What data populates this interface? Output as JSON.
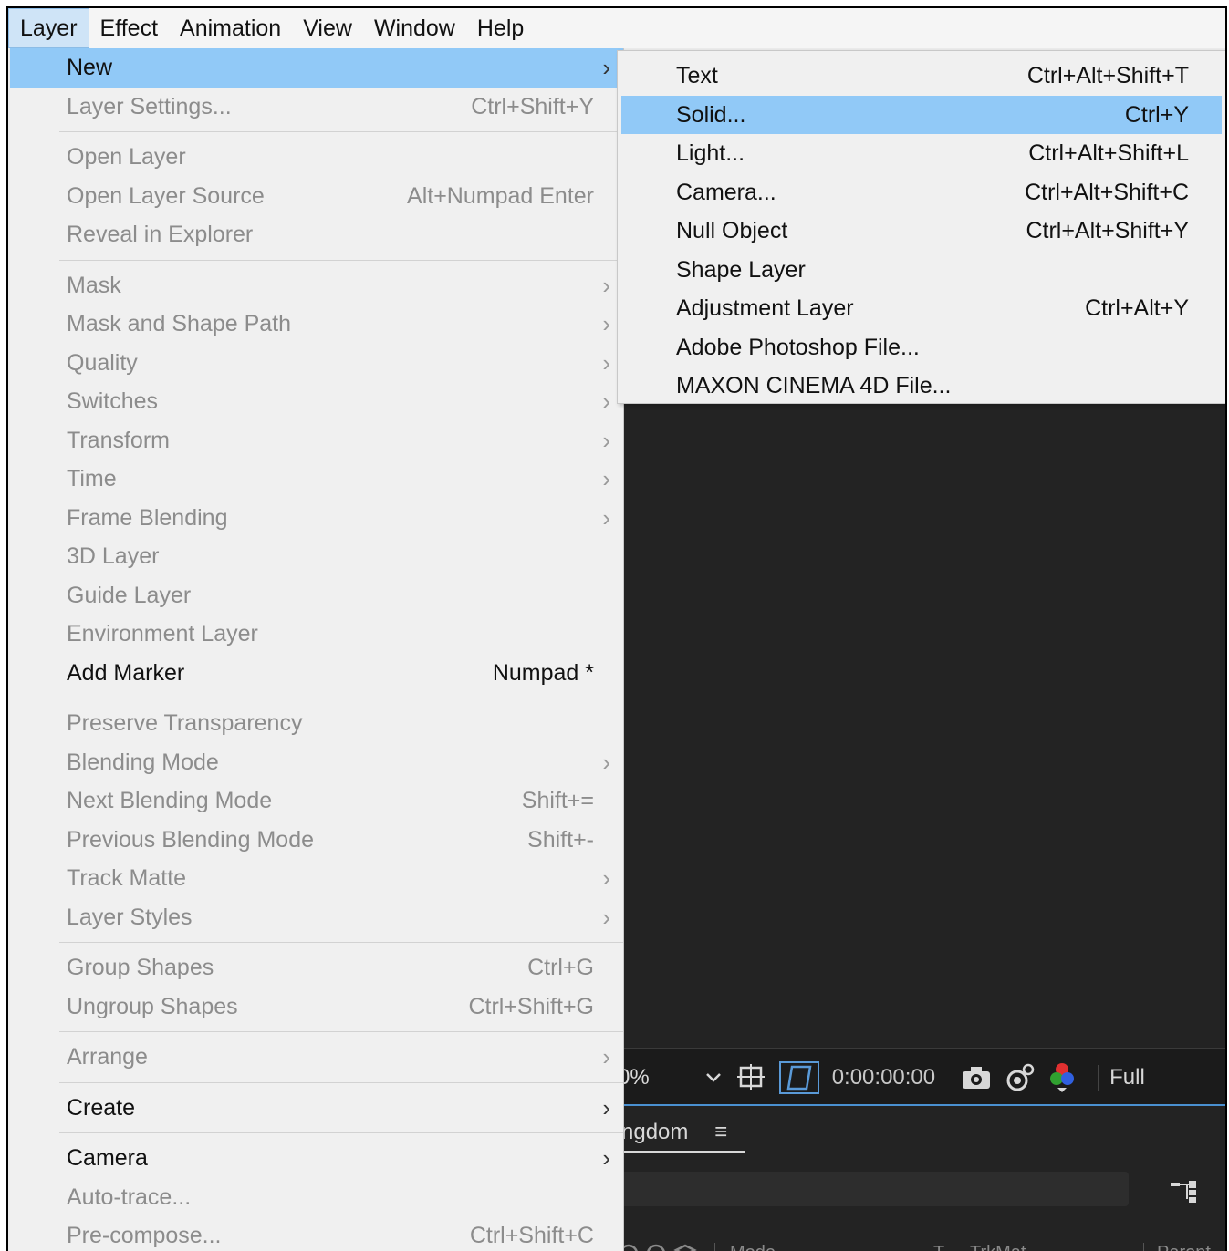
{
  "menubar": {
    "items": [
      "Layer",
      "Effect",
      "Animation",
      "View",
      "Window",
      "Help"
    ],
    "active": "Layer"
  },
  "layer_menu": {
    "new": {
      "label": "New"
    },
    "layer_settings": {
      "label": "Layer Settings...",
      "shortcut": "Ctrl+Shift+Y"
    },
    "open_layer": {
      "label": "Open Layer"
    },
    "open_layer_source": {
      "label": "Open Layer Source",
      "shortcut": "Alt+Numpad Enter"
    },
    "reveal_in_explorer": {
      "label": "Reveal in Explorer"
    },
    "mask": {
      "label": "Mask"
    },
    "mask_and_shape_path": {
      "label": "Mask and Shape Path"
    },
    "quality": {
      "label": "Quality"
    },
    "switches": {
      "label": "Switches"
    },
    "transform": {
      "label": "Transform"
    },
    "time": {
      "label": "Time"
    },
    "frame_blending": {
      "label": "Frame Blending"
    },
    "three_d_layer": {
      "label": "3D Layer"
    },
    "guide_layer": {
      "label": "Guide Layer"
    },
    "environment_layer": {
      "label": "Environment Layer"
    },
    "add_marker": {
      "label": "Add Marker",
      "shortcut": "Numpad *"
    },
    "preserve_transparency": {
      "label": "Preserve Transparency"
    },
    "blending_mode": {
      "label": "Blending Mode"
    },
    "next_blending_mode": {
      "label": "Next Blending Mode",
      "shortcut": "Shift+="
    },
    "previous_blending_mode": {
      "label": "Previous Blending Mode",
      "shortcut": "Shift+-"
    },
    "track_matte": {
      "label": "Track Matte"
    },
    "layer_styles": {
      "label": "Layer Styles"
    },
    "group_shapes": {
      "label": "Group Shapes",
      "shortcut": "Ctrl+G"
    },
    "ungroup_shapes": {
      "label": "Ungroup Shapes",
      "shortcut": "Ctrl+Shift+G"
    },
    "arrange": {
      "label": "Arrange"
    },
    "create": {
      "label": "Create"
    },
    "camera": {
      "label": "Camera"
    },
    "auto_trace": {
      "label": "Auto-trace..."
    },
    "pre_compose": {
      "label": "Pre-compose...",
      "shortcut": "Ctrl+Shift+C"
    }
  },
  "new_submenu": {
    "text": {
      "label": "Text",
      "shortcut": "Ctrl+Alt+Shift+T"
    },
    "solid": {
      "label": "Solid...",
      "shortcut": "Ctrl+Y"
    },
    "light": {
      "label": "Light...",
      "shortcut": "Ctrl+Alt+Shift+L"
    },
    "camera": {
      "label": "Camera...",
      "shortcut": "Ctrl+Alt+Shift+C"
    },
    "null_object": {
      "label": "Null Object",
      "shortcut": "Ctrl+Alt+Shift+Y"
    },
    "shape_layer": {
      "label": "Shape Layer"
    },
    "adjustment_layer": {
      "label": "Adjustment Layer",
      "shortcut": "Ctrl+Alt+Y"
    },
    "photoshop_file": {
      "label": "Adobe Photoshop File..."
    },
    "cinema4d_file": {
      "label": "MAXON CINEMA 4D File..."
    }
  },
  "viewer": {
    "zoom_partial": "0%",
    "timecode": "0:00:00:00",
    "resolution": "Full"
  },
  "timeline": {
    "tab_partial": "ngdom",
    "tab_menu_glyph": "≡",
    "col_mode": "Mode",
    "col_t": "T",
    "col_trkmat": "TrkMat",
    "col_parent": "Parent &"
  },
  "colors": {
    "highlight": "#91c9f7",
    "menu_bg": "#f0f0f0",
    "disabled_text": "#8c8c8c",
    "app_dark": "#232323"
  }
}
